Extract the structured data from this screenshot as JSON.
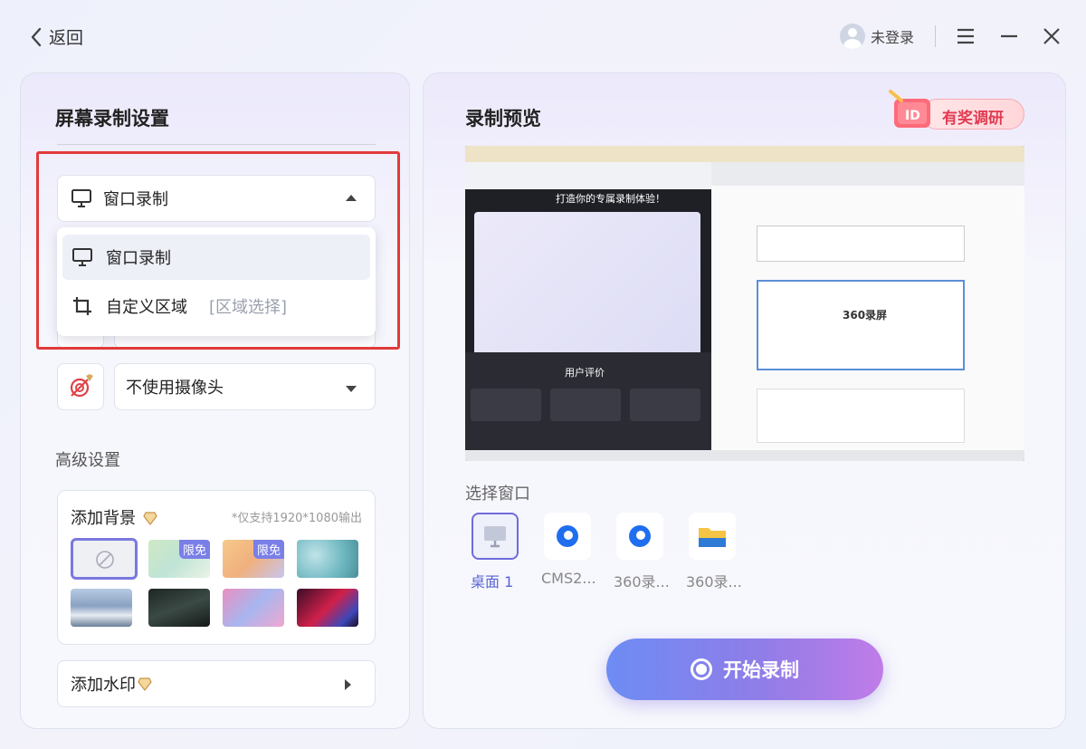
{
  "header": {
    "back_label": "返回",
    "user_label": "未登录"
  },
  "settings": {
    "title": "屏幕录制设置",
    "mode_selected": "窗口录制",
    "dropdown_options": [
      {
        "label": "窗口录制"
      },
      {
        "label": "自定义区域",
        "hint": "[区域选择]"
      }
    ],
    "camera_selected": "不使用摄像头",
    "advanced_title": "高级设置",
    "background": {
      "title": "添加背景",
      "note": "*仅支持1920*1080输出",
      "badges": [
        "限免",
        "限免"
      ]
    },
    "watermark_title": "添加水印"
  },
  "preview": {
    "title": "录制预览",
    "survey_label": "有奖调研",
    "preview_texts": {
      "headline": "打造你的专属录制体验！",
      "reviews": "用户评价",
      "brand": "360录屏"
    },
    "select_window_title": "选择窗口",
    "windows": [
      {
        "label": "桌面 1",
        "icon": "monitor-icon"
      },
      {
        "label": "CMS2...",
        "icon": "cms-app-icon"
      },
      {
        "label": "360录...",
        "icon": "360-app-icon"
      },
      {
        "label": "360录...",
        "icon": "folder-icon"
      }
    ],
    "start_label": "开始录制"
  },
  "colors": {
    "accent": "#6e6bdc",
    "highlight_box": "#e23a3a",
    "survey_text": "#e23b52"
  }
}
